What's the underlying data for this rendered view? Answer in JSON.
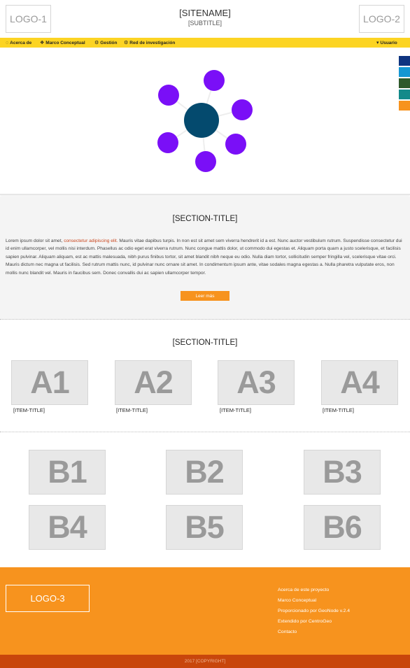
{
  "header": {
    "logo_left": "LOGO-1",
    "logo_right": "LOGO-2",
    "site_name": "[SITENAME]",
    "subtitle": "[SUBTITLE]"
  },
  "nav": {
    "items": [
      {
        "label": "Acerca de",
        "icon": "spinner-icon"
      },
      {
        "label": "Marco Conceptual",
        "icon": "cubes-icon"
      },
      {
        "label": "Gestión",
        "icon": "gear-icon"
      },
      {
        "label": "Red de investigación",
        "icon": "gears-icon"
      }
    ],
    "user_label": "Usuario",
    "user_icon": "user-icon"
  },
  "hero": {
    "swatches": [
      "#0f3480",
      "#1597d3",
      "#2f5a2c",
      "#138a8a",
      "#f7931e"
    ],
    "center_color": "#044a6e",
    "node_color": "#7a0ff7",
    "edge_color": "#eeeeee"
  },
  "intro": {
    "title": "[SECTION-TITLE]",
    "text_before": "Lorem ipsum dolor sit amet, ",
    "link_text": "consectetur adipiscing elit.",
    "text_after": " Mauris vitae dapibus turpis. In non est sit amet sem viverra hendrerit id a est. Nunc auctor vestibulum rutrum. Suspendisse consectetur dui id enim ullamcorper, vel mollis nisi interdum. Phasellus ac odio eget erat viverra rutrum. Nunc congue mattis dolor, ut commodo dui egestas et. Aliquam porta quam a justo scelerisque, et facilisis sapien pulvinar. Aliquam aliquam, est ac mattis malesuada, nibh purus finibus tortor, sit amet blandit nibh neque eu odio. Nulla diam tortor, sollicitudin semper fringilla vel, scelerisque vitae orci. Mauris dictum nec magna ut facilisis. Sed rutrum mattis nunc, id pulvinar nunc ornare sit amet. In condimentum ipsum ante, vitae sodales magna egestas a. Nulla pharetra vulputate eros, non mollis nunc blandit vel. Mauris in faucibus sem. Donec convallis dui ac sapien ullamcorper tempor.",
    "button_label": "Leer más"
  },
  "section_a": {
    "title": "[SECTION-TITLE]",
    "items": [
      {
        "tile": "A1",
        "title": "[ITEM-TITLE]"
      },
      {
        "tile": "A2",
        "title": "[ITEM-TITLE]"
      },
      {
        "tile": "A3",
        "title": "[ITEM-TITLE]"
      },
      {
        "tile": "A4",
        "title": "[ITEM-TITLE]"
      }
    ]
  },
  "section_b": {
    "tiles": [
      "B1",
      "B2",
      "B3",
      "B4",
      "B5",
      "B6"
    ]
  },
  "footer": {
    "logo": "LOGO-3",
    "links": [
      "Acerca de este proyecto",
      "Marco Conceptual",
      "Proporcionado por GeoNode v.2.4",
      "Extendido por CentroGeo",
      "Contacto"
    ],
    "copyright": "2017 [COPYRIGHT]"
  }
}
